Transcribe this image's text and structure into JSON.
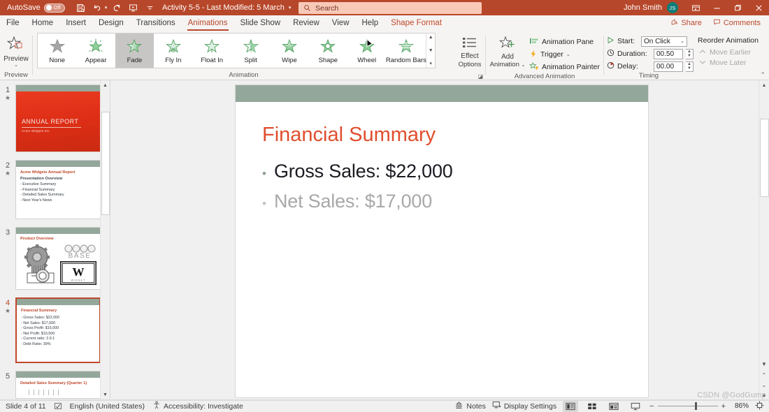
{
  "titlebar": {
    "autosave_label": "AutoSave",
    "autosave_state": "Off",
    "quick_access": [
      {
        "name": "save-button",
        "label": "Save"
      },
      {
        "name": "undo-button",
        "label": "Undo"
      },
      {
        "name": "redo-button",
        "label": "Redo"
      },
      {
        "name": "start-from-beginning-button",
        "label": "Start From Beginning"
      },
      {
        "name": "customize-quick-access-toolbar-button",
        "label": "Customize Quick Access Toolbar"
      }
    ],
    "document_title": "Activity 5-5  -  Last Modified: 5 March",
    "search_placeholder": "Search",
    "user_name": "John Smith",
    "user_initials": "JS",
    "window_buttons": [
      "Ribbon Display Options",
      "Minimize",
      "Restore",
      "Close"
    ]
  },
  "ribbon": {
    "tabs": [
      {
        "label": "File",
        "active": false,
        "contextual": false
      },
      {
        "label": "Home",
        "active": false,
        "contextual": false
      },
      {
        "label": "Insert",
        "active": false,
        "contextual": false
      },
      {
        "label": "Design",
        "active": false,
        "contextual": false
      },
      {
        "label": "Transitions",
        "active": false,
        "contextual": false
      },
      {
        "label": "Animations",
        "active": true,
        "contextual": false
      },
      {
        "label": "Slide Show",
        "active": false,
        "contextual": false
      },
      {
        "label": "Review",
        "active": false,
        "contextual": false
      },
      {
        "label": "View",
        "active": false,
        "contextual": false
      },
      {
        "label": "Help",
        "active": false,
        "contextual": false
      },
      {
        "label": "Shape Format",
        "active": false,
        "contextual": true
      }
    ],
    "share_label": "Share",
    "comments_label": "Comments",
    "preview_group": {
      "title": "Preview",
      "button_label": "Preview"
    },
    "animation_group": {
      "title": "Animation",
      "effects": [
        {
          "label": "None",
          "selected": false
        },
        {
          "label": "Appear",
          "selected": false
        },
        {
          "label": "Fade",
          "selected": true
        },
        {
          "label": "Fly In",
          "selected": false
        },
        {
          "label": "Float In",
          "selected": false
        },
        {
          "label": "Split",
          "selected": false
        },
        {
          "label": "Wipe",
          "selected": false
        },
        {
          "label": "Shape",
          "selected": false
        },
        {
          "label": "Wheel",
          "selected": false
        },
        {
          "label": "Random Bars",
          "selected": false
        }
      ],
      "effect_options_label": "Effect\nOptions"
    },
    "effect_options": {
      "line1": "Effect",
      "line2": "Options"
    },
    "advanced_animation_group": {
      "title": "Advanced Animation",
      "add_animation_line1": "Add",
      "add_animation_line2": "Animation",
      "animation_pane_label": "Animation Pane",
      "trigger_label": "Trigger",
      "animation_painter_label": "Animation Painter"
    },
    "timing_group": {
      "title": "Timing",
      "start_label": "Start:",
      "start_value": "On Click",
      "duration_label": "Duration:",
      "duration_value": "00.50",
      "delay_label": "Delay:",
      "delay_value": "00.00"
    },
    "reorder_group": {
      "title": "Reorder Animation",
      "move_earlier_label": "Move Earlier",
      "move_later_label": "Move Later"
    }
  },
  "thumbnails": [
    {
      "number": "1",
      "has_animation_star": true,
      "active": false,
      "type": "title",
      "title": "ANNUAL REPORT",
      "subtitle": "Acme Widgets Inc."
    },
    {
      "number": "2",
      "has_animation_star": true,
      "active": false,
      "type": "bullets",
      "title": "Acme Widgets Annual Report",
      "heading": "Presentation Overview",
      "items": [
        "- Executive Summary",
        "- Financial Summary",
        "- Detailed Sales Summary",
        "- Next Year's News"
      ]
    },
    {
      "number": "3",
      "has_animation_star": false,
      "active": false,
      "type": "art",
      "title": "Product Overview",
      "art_label_base": "BASE",
      "art_label_w": "W"
    },
    {
      "number": "4",
      "has_animation_star": true,
      "active": true,
      "type": "bullets",
      "title": "Financial Summary",
      "items": [
        "- Gross Sales: $22,000",
        "- Net Sales: $17,000",
        "- Gross Profit: $15,000",
        "- Net Profit: $10,500",
        "- Current ratio: 2.6:1",
        "- Debt Ratio: 39%"
      ]
    },
    {
      "number": "5",
      "has_animation_star": false,
      "active": false,
      "type": "partial",
      "title": "Detailed Sales Summary (Quarter 1)"
    }
  ],
  "slide": {
    "title": "Financial Summary",
    "bullets": [
      {
        "text": "Gross Sales: $22,000",
        "dimmed": false
      },
      {
        "text": "Net Sales: $17,000",
        "dimmed": true
      }
    ]
  },
  "statusbar": {
    "slide_counter": "Slide 4 of 11",
    "language": "English (United States)",
    "accessibility": "Accessibility: Investigate",
    "notes_label": "Notes",
    "display_settings_label": "Display Settings",
    "views": [
      {
        "name": "normal-view",
        "label": "Normal",
        "active": true
      },
      {
        "name": "slide-sorter-view",
        "label": "Slide Sorter",
        "active": false
      },
      {
        "name": "reading-view",
        "label": "Reading View",
        "active": false
      },
      {
        "name": "slide-show-view",
        "label": "Slide Show",
        "active": false
      }
    ],
    "zoom_out": "−",
    "zoom_in": "+",
    "zoom_percent": "86%",
    "fit_label": "Fit slide to current window"
  },
  "watermark": "CSDN @GodGump",
  "colors": {
    "titlebar": "#b7472a",
    "accent_red": "#c0482a",
    "slide_title": "#e04e2f",
    "slide_bar_green": "#94a79b",
    "star_green": "#5aa664"
  }
}
